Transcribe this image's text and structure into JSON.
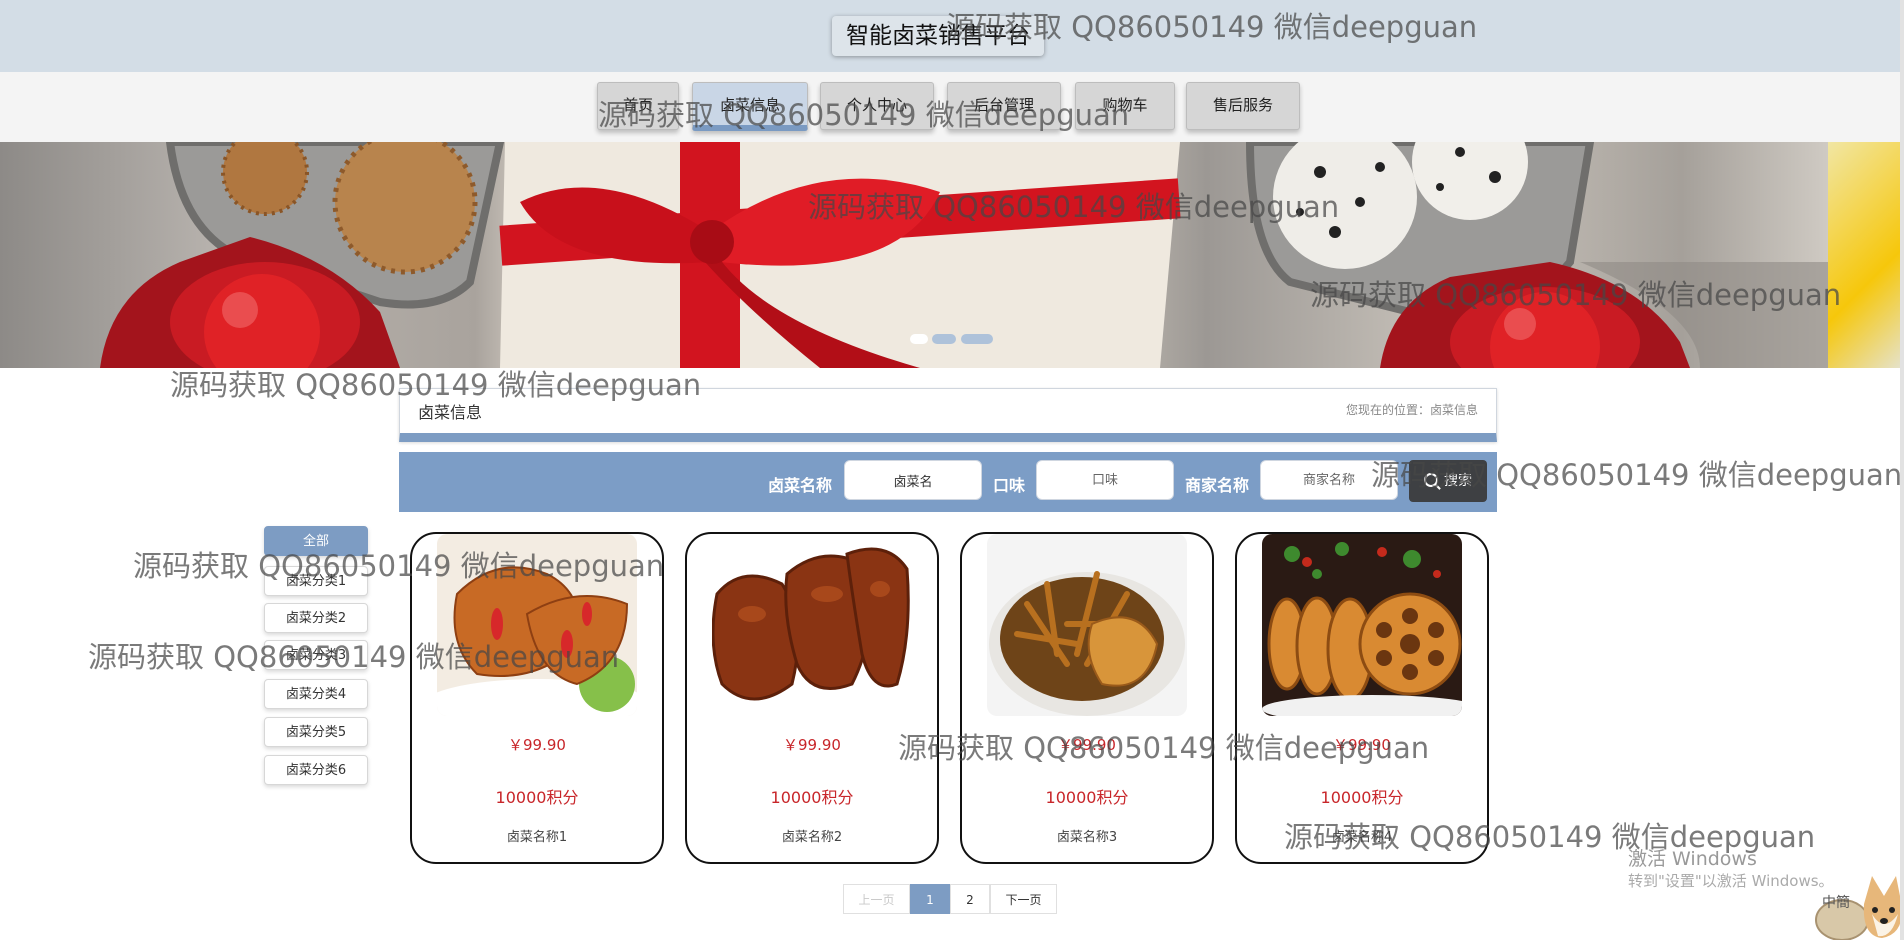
{
  "header": {
    "site_title": "智能卤菜销售平台"
  },
  "nav": [
    {
      "label": "首页",
      "active": false
    },
    {
      "label": "卤菜信息",
      "active": true
    },
    {
      "label": "个人中心",
      "active": false
    },
    {
      "label": "后台管理",
      "active": false
    },
    {
      "label": "购物车",
      "active": false
    },
    {
      "label": "售后服务",
      "active": false
    }
  ],
  "banner": {
    "dots": 3,
    "active_dot": 1
  },
  "section": {
    "title": "卤菜信息",
    "breadcrumb": "您现在的位置：卤菜信息"
  },
  "search": {
    "name_label": "卤菜名称",
    "name_value": "卤菜名",
    "taste_label": "口味",
    "taste_placeholder": "口味",
    "merchant_label": "商家名称",
    "merchant_placeholder": "商家名称",
    "button_label": "搜索"
  },
  "categories": [
    {
      "label": "全部",
      "active": true
    },
    {
      "label": "卤菜分类1",
      "active": false
    },
    {
      "label": "卤菜分类2",
      "active": false
    },
    {
      "label": "卤菜分类3",
      "active": false
    },
    {
      "label": "卤菜分类4",
      "active": false
    },
    {
      "label": "卤菜分类5",
      "active": false
    },
    {
      "label": "卤菜分类6",
      "active": false
    }
  ],
  "products": [
    {
      "price": "￥99.90",
      "points": "10000积分",
      "name": "卤菜名称1",
      "image": "braised-duck-feet"
    },
    {
      "price": "￥99.90",
      "points": "10000积分",
      "name": "卤菜名称2",
      "image": "braised-pork-trotters"
    },
    {
      "price": "￥99.90",
      "points": "10000积分",
      "name": "卤菜名称3",
      "image": "braised-chicken-feet"
    },
    {
      "price": "￥99.90",
      "points": "10000积分",
      "name": "卤菜名称4",
      "image": "braised-lotus-root"
    }
  ],
  "pagination": {
    "prev": "上一页",
    "pages": [
      "1",
      "2"
    ],
    "current": "1",
    "next": "下一页"
  },
  "watermark_text": "源码获取 QQ86050149 微信deepguan",
  "os_overlay": {
    "activate_title": "激活 Windows",
    "activate_sub": "转到\"设置\"以激活 Windows。",
    "ime_label": "中簡"
  },
  "colors": {
    "accent": "#7d9cc3",
    "price": "#c8262a",
    "header_bg": "#d3dde6",
    "search_button": "#3e4043"
  }
}
